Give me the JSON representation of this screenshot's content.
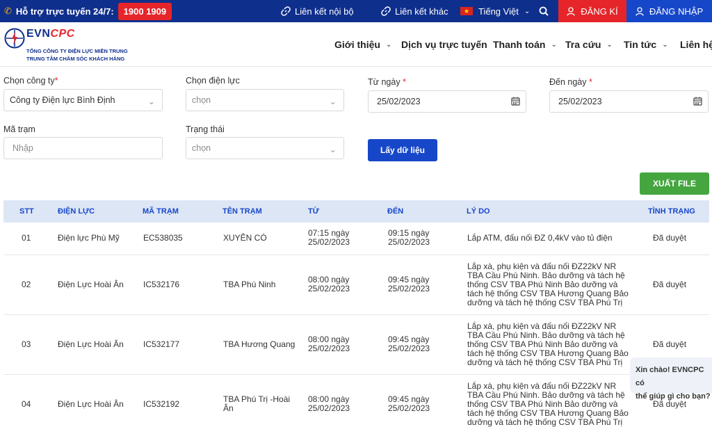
{
  "topbar": {
    "hotline_label": "Hỗ trợ trực tuyến 24/7:",
    "hotline_number": "1900 1909",
    "internal_link": "Liên kết nội bộ",
    "other_link": "Liên kết khác",
    "language": "Tiếng Việt",
    "register": "ĐĂNG KÍ",
    "login": "ĐĂNG NHẬP"
  },
  "header": {
    "logo_evn": "EVN",
    "logo_cpc": "CPC",
    "logo_sub1": "TỔNG CÔNG TY ĐIỆN LỰC MIỀN TRUNG",
    "logo_sub2": "TRUNG TÂM CHĂM SÓC KHÁCH HÀNG",
    "nav": [
      "Giới thiệu",
      "Dịch vụ trực tuyến",
      "Thanh toán",
      "Tra cứu",
      "Tin tức",
      "Liên hệ"
    ]
  },
  "form": {
    "company_label": "Chọn công ty",
    "company_value": "Công ty Điện lực Bình Định",
    "power_label": "Chọn điện lực",
    "power_placeholder": "chọn",
    "from_label": "Từ ngày",
    "from_value": "25/02/2023",
    "to_label": "Đến ngày",
    "to_value": "25/02/2023",
    "station_label": "Mã trạm",
    "station_placeholder": "Nhập",
    "status_label": "Trạng thái",
    "status_placeholder": "chọn",
    "required_mark": "*",
    "get_data": "Lấy dữ liệu",
    "export": "XUẤT FILE"
  },
  "table": {
    "headers": [
      "STT",
      "ĐIỆN LỰC",
      "MÃ TRẠM",
      "TÊN TRẠM",
      "TỪ",
      "ĐẾN",
      "LÝ DO",
      "TÌNH TRẠNG"
    ],
    "rows": [
      {
        "stt": "01",
        "power": "Điện lực Phù Mỹ",
        "code": "EC538035",
        "name": "XUYÊN CÓ",
        "from1": "07:15 ngày",
        "from2": "25/02/2023",
        "to1": "09:15 ngày",
        "to2": "25/02/2023",
        "reason": [
          "Lắp ATM, đấu nối ĐZ 0,4kV vào tủ điện"
        ],
        "status": "Đã duyệt"
      },
      {
        "stt": "02",
        "power": "Điện Lực Hoài Ân",
        "code": "IC532176",
        "name": "TBA Phú Ninh",
        "from1": "08:00 ngày",
        "from2": "25/02/2023",
        "to1": "09:45 ngày",
        "to2": "25/02/2023",
        "reason": [
          "Lắp xà, phụ kiện và đấu nối ĐZ22kV NR",
          "TBA Cầu Phú Ninh. Bảo dưỡng và tách hệ",
          "thống CSV TBA Phú Ninh Bảo dưỡng và",
          "tách hệ thống CSV TBA Hương Quang Bảo",
          "dưỡng và tách hệ thống CSV TBA Phú Trị"
        ],
        "status": "Đã duyệt"
      },
      {
        "stt": "03",
        "power": "Điện Lực Hoài Ân",
        "code": "IC532177",
        "name": "TBA Hương Quang",
        "from1": "08:00 ngày",
        "from2": "25/02/2023",
        "to1": "09:45 ngày",
        "to2": "25/02/2023",
        "reason": [
          "Lắp xà, phụ kiện và đấu nối ĐZ22kV NR",
          "TBA Cầu Phú Ninh. Bảo dưỡng và tách hệ",
          "thống CSV TBA Phú Ninh Bảo dưỡng và",
          "tách hệ thống CSV TBA Hương Quang Bảo",
          "dưỡng và tách hệ thống CSV TBA Phú Trị"
        ],
        "status": "Đã duyệt"
      },
      {
        "stt": "04",
        "power": "Điện Lực Hoài Ân",
        "code": "IC532192",
        "name": "TBA Phú Trị -Hoài Ân",
        "from1": "08:00 ngày",
        "from2": "25/02/2023",
        "to1": "09:45 ngày",
        "to2": "25/02/2023",
        "reason": [
          "Lắp xà, phụ kiện và đấu nối ĐZ22kV NR",
          "TBA Cầu Phú Ninh. Bảo dưỡng và tách hệ",
          "thống CSV TBA Phú Ninh Bảo dưỡng và",
          "tách hệ thống CSV TBA Hương Quang Bảo",
          "dưỡng và tách hệ thống CSV TBA Phú Trị"
        ],
        "status": "Đã duyệt"
      }
    ]
  },
  "chat": {
    "line1": "Xin chào! EVNCPC có",
    "line2": "thể giúp gì cho bạn?"
  }
}
